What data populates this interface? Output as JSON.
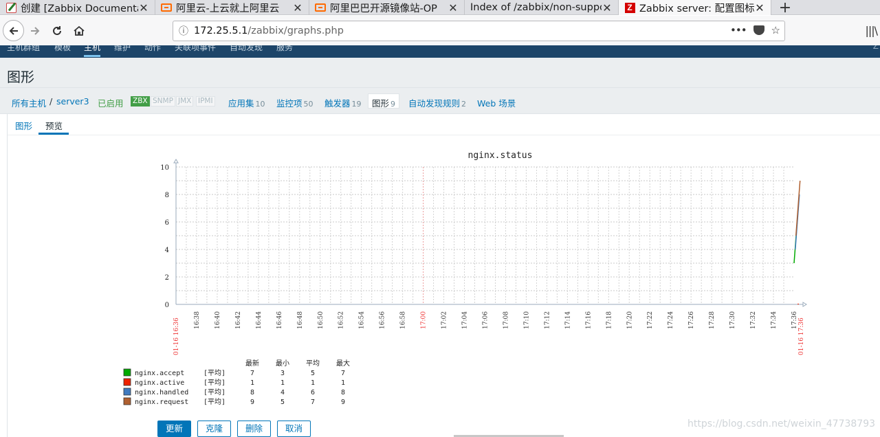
{
  "browser": {
    "tabs": [
      {
        "icon": "edit-icon",
        "title": "创建 [Zabbix Documentati",
        "active": false
      },
      {
        "icon": "aliyun-icon",
        "title": "阿里云-上云就上阿里云",
        "active": false
      },
      {
        "icon": "aliyun-icon",
        "title": "阿里巴巴开源镜像站-OP",
        "active": false
      },
      {
        "icon": "",
        "title": "Index of /zabbix/non-support",
        "active": false
      },
      {
        "icon": "zabbix-icon",
        "title": "Zabbix server: 配置图标",
        "active": true
      }
    ],
    "zabbix_icon_letter": "Z",
    "close_glyph": "✕",
    "new_tab_glyph": "+",
    "url_host": "172.25.5.1",
    "url_path": "/zabbix/graphs.php",
    "page_actions_glyph": "•••"
  },
  "zabbix_menu": {
    "items": [
      "主机群组",
      "模板",
      "主机",
      "维护",
      "动作",
      "关联项事件",
      "自动发现",
      "服务"
    ],
    "active_index": 2,
    "right_text": "Z"
  },
  "page": {
    "title": "图形"
  },
  "host_nav": {
    "all_hosts": "所有主机",
    "separator": "/",
    "host": "server3",
    "status": "已启用",
    "protocols": [
      "ZBX",
      "SNMP",
      "JMX",
      "IPMI"
    ],
    "applications": {
      "label": "应用集",
      "count": "10"
    },
    "items": {
      "label": "监控项",
      "count": "50"
    },
    "triggers": {
      "label": "触发器",
      "count": "19"
    },
    "graphs": {
      "label": "图形",
      "count": "9"
    },
    "discovery": {
      "label": "自动发现规则",
      "count": "2"
    },
    "web": {
      "label": "Web 场景"
    }
  },
  "subtabs": {
    "graph": "图形",
    "preview": "预览"
  },
  "chart_data": {
    "type": "line",
    "title": "nginx.status",
    "ylim": [
      0,
      10
    ],
    "yticks": [
      "0",
      "2",
      "4",
      "6",
      "8",
      "10"
    ],
    "xticks": [
      "16:38",
      "16:40",
      "16:42",
      "16:44",
      "16:46",
      "16:48",
      "16:50",
      "16:52",
      "16:54",
      "16:56",
      "16:58",
      "17:00",
      "17:02",
      "17:04",
      "17:06",
      "17:08",
      "17:10",
      "17:12",
      "17:14",
      "17:16",
      "17:18",
      "17:20",
      "17:22",
      "17:24",
      "17:26",
      "17:28",
      "17:30",
      "17:32",
      "17:34",
      "17:36"
    ],
    "x_start_label": "01-16 16:36",
    "x_end_label": "01-16 17:36",
    "grid": true,
    "series": [
      {
        "name": "nginx.accept",
        "color": "#00aa00",
        "x": [
          "17:36",
          "17:36",
          "17:36"
        ],
        "values": [
          3,
          5,
          7
        ],
        "agg": "[平均]",
        "last": "7",
        "min": "3",
        "avg": "5",
        "max": "7"
      },
      {
        "name": "nginx.active",
        "color": "#ee2200",
        "x": [
          "17:36",
          "17:36"
        ],
        "values": [
          1,
          1
        ],
        "agg": "[平均]",
        "last": "1",
        "min": "1",
        "avg": "1",
        "max": "1"
      },
      {
        "name": "nginx.handled",
        "color": "#3f7abf",
        "x": [
          "17:36",
          "17:36",
          "17:36"
        ],
        "values": [
          4,
          6,
          8
        ],
        "agg": "[平均]",
        "last": "8",
        "min": "4",
        "avg": "6",
        "max": "8"
      },
      {
        "name": "nginx.request",
        "color": "#b06030",
        "x": [
          "17:36",
          "17:36",
          "17:36"
        ],
        "values": [
          5,
          7,
          9
        ],
        "agg": "[平均]",
        "last": "9",
        "min": "5",
        "avg": "7",
        "max": "9"
      }
    ],
    "legend_headers": [
      "最新",
      "最小",
      "平均",
      "最大"
    ]
  },
  "buttons": {
    "update": "更新",
    "clone": "克隆",
    "delete": "删除",
    "cancel": "取消"
  },
  "watermark": "https://blog.csdn.net/weixin_47738793"
}
